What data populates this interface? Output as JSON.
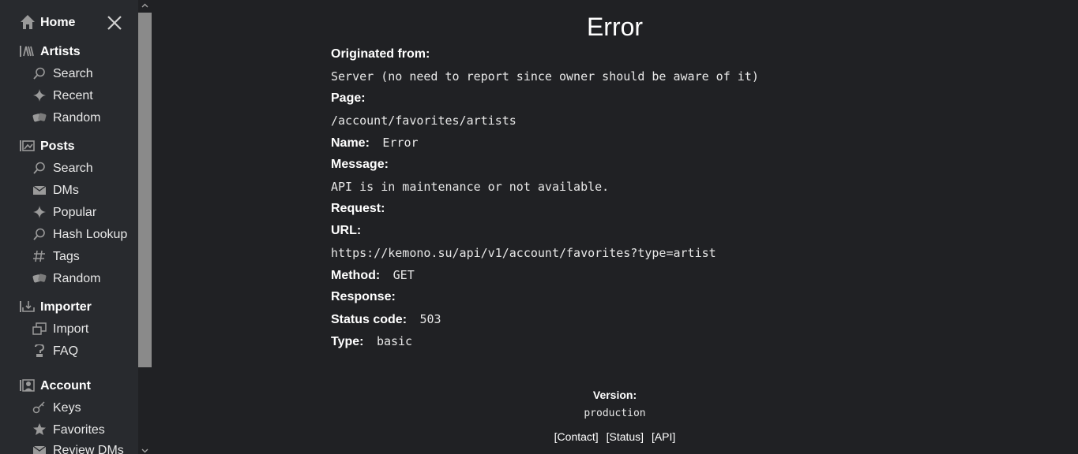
{
  "sidebar": {
    "home_label": "Home",
    "sections": {
      "artists": {
        "label": "Artists",
        "items": [
          "Search",
          "Recent",
          "Random"
        ]
      },
      "posts": {
        "label": "Posts",
        "items": [
          "Search",
          "DMs",
          "Popular",
          "Hash Lookup",
          "Tags",
          "Random"
        ]
      },
      "importer": {
        "label": "Importer",
        "items": [
          "Import",
          "FAQ"
        ]
      },
      "account": {
        "label": "Account",
        "items": [
          "Keys",
          "Favorites",
          "Review DMs"
        ]
      }
    }
  },
  "error": {
    "title": "Error",
    "originated_label": "Originated from:",
    "originated_value": "Server (no need to report since owner should be aware of it)",
    "page_label": "Page:",
    "page_value": "/account/favorites/artists",
    "name_label": "Name:",
    "name_value": "Error",
    "message_label": "Message:",
    "message_value": "API is in maintenance or not available.",
    "request_label": "Request:",
    "url_label": "URL:",
    "url_value": "https://kemono.su/api/v1/account/favorites?type=artist",
    "method_label": "Method:",
    "method_value": "GET",
    "response_label": "Response:",
    "status_label": "Status code:",
    "status_value": "503",
    "type_label": "Type:",
    "type_value": "basic"
  },
  "footer": {
    "version_label": "Version:",
    "version_value": "production",
    "links": [
      "[Contact]",
      "[Status]",
      "[API]"
    ]
  },
  "colors": {
    "background": "#202124",
    "sidebar": "#282a2e",
    "icon": "#9a9a9a",
    "scroll_thumb": "#8a8a8a"
  }
}
